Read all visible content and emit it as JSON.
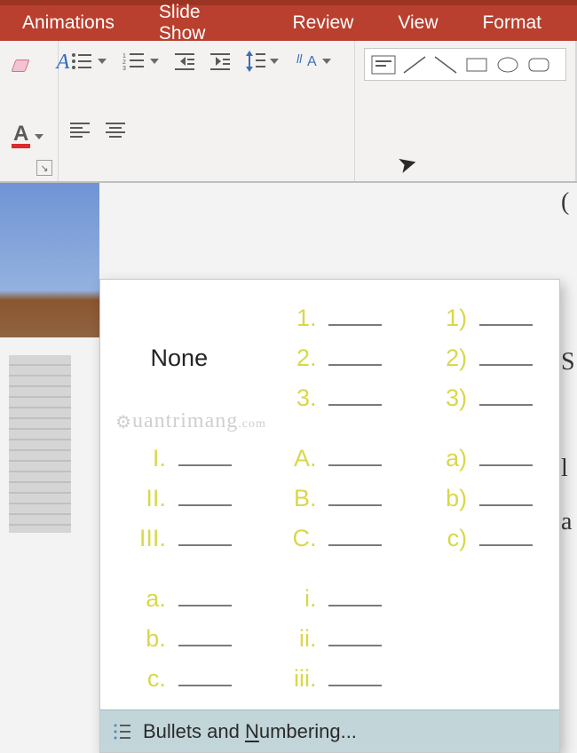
{
  "ribbon": {
    "tabs": {
      "animations": "Animations",
      "slide_show": "Slide Show",
      "review": "Review",
      "view": "View",
      "format": "Format"
    }
  },
  "numbering_panel": {
    "none_label": "None",
    "bullets_numbering_label_pre": "Bullets and ",
    "bullets_numbering_label_u": "N",
    "bullets_numbering_label_post": "umbering...",
    "options": {
      "none": {
        "kind": "none"
      },
      "decimal_dot": {
        "lines": [
          "1.",
          "2.",
          "3."
        ]
      },
      "decimal_paren": {
        "lines": [
          "1)",
          "2)",
          "3)"
        ]
      },
      "upper_roman": {
        "lines": [
          "I.",
          "II.",
          "III."
        ]
      },
      "upper_alpha": {
        "lines": [
          "A.",
          "B.",
          "C."
        ]
      },
      "lower_alpha_paren": {
        "lines": [
          "a)",
          "b)",
          "c)"
        ]
      },
      "lower_alpha_dot": {
        "lines": [
          "a.",
          "b.",
          "c."
        ]
      },
      "lower_roman": {
        "lines": [
          "i.",
          "ii.",
          "iii."
        ]
      },
      "blank": {
        "kind": "blank"
      }
    }
  },
  "watermark": {
    "text": "uantrimang",
    "suffix": ".com"
  },
  "peek_text": "(\n\n\nS\n\nl\na\n\ne"
}
